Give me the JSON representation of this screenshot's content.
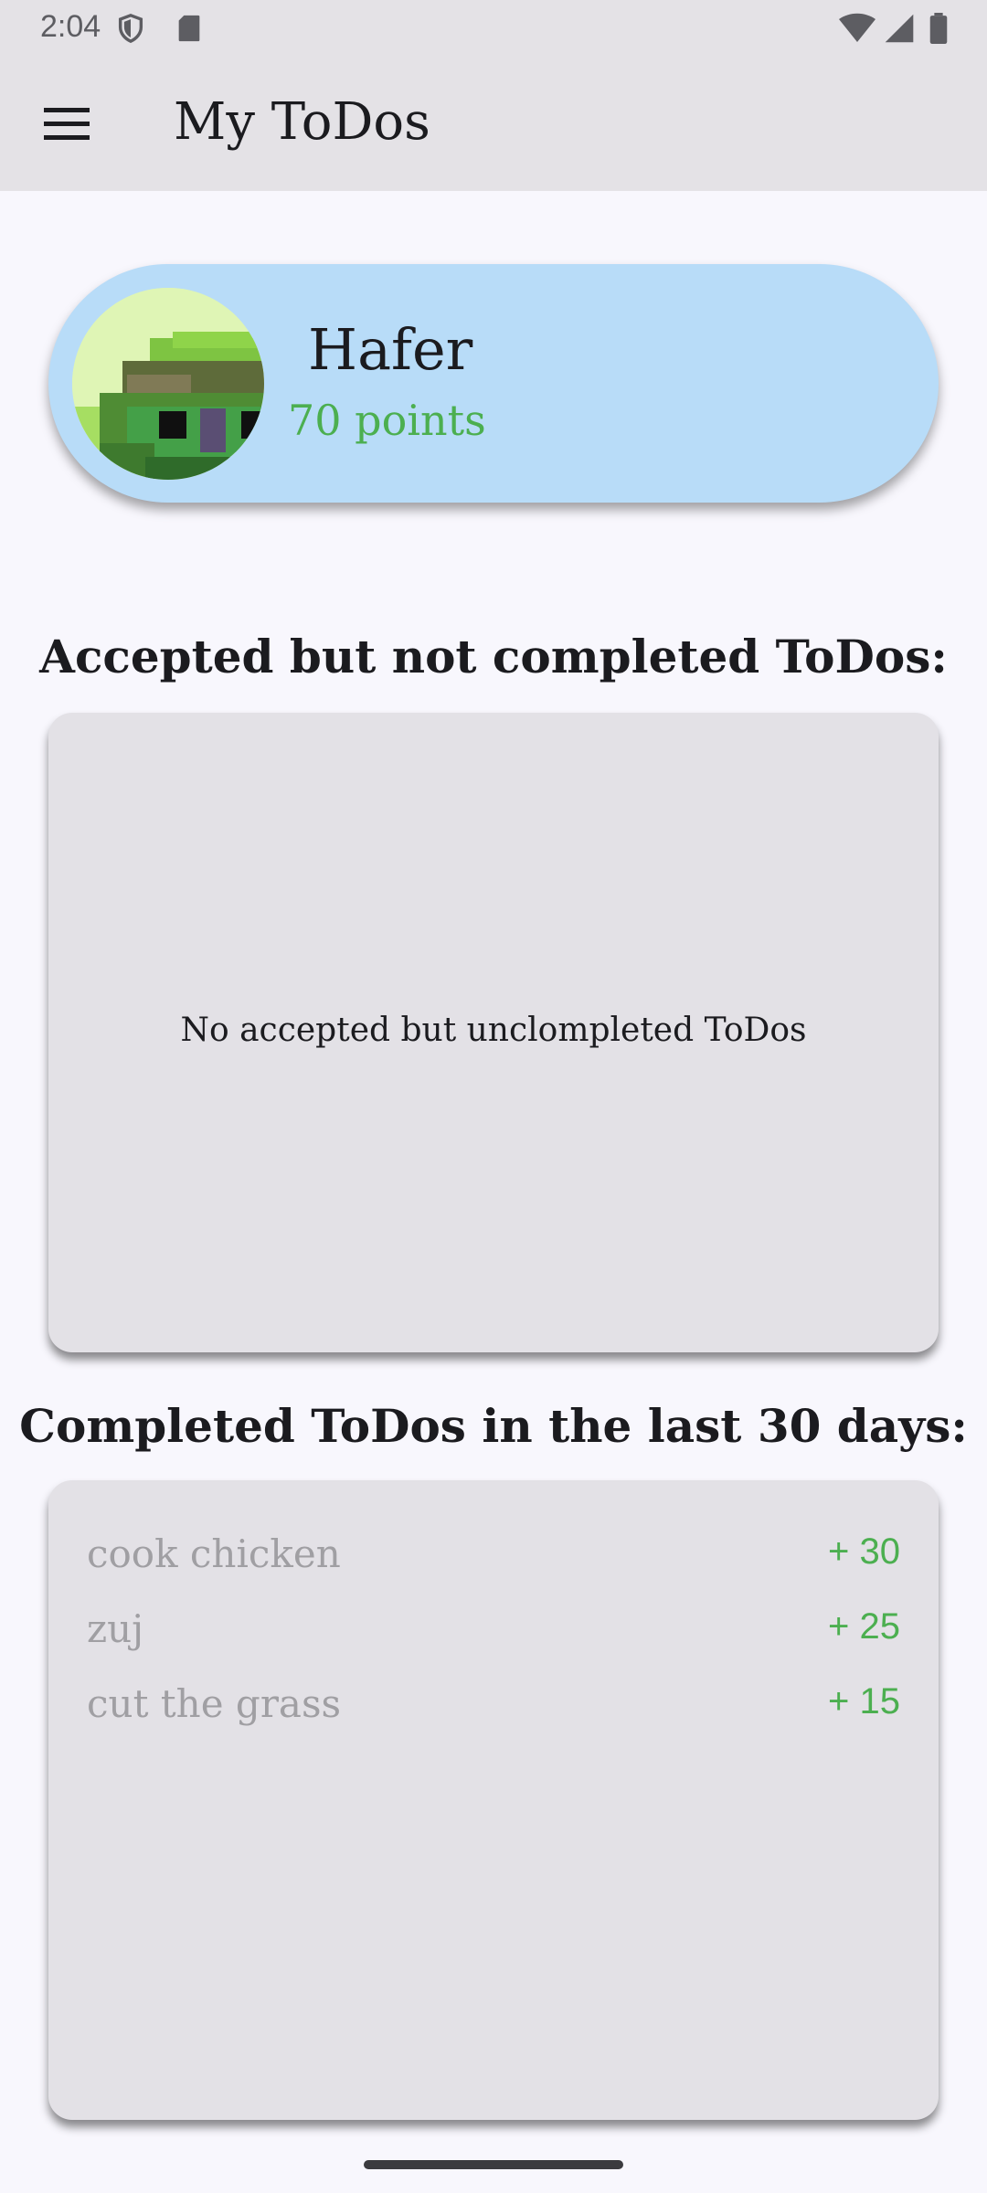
{
  "status_bar": {
    "time": "2:04",
    "icons_left": [
      "shield-icon",
      "sd-card-icon"
    ],
    "icons_right": [
      "wifi-icon",
      "signal-icon",
      "battery-icon"
    ]
  },
  "app_bar": {
    "title": "My ToDos",
    "menu_icon": "hamburger-menu-icon"
  },
  "profile": {
    "name": "Hafer",
    "points": "70 points",
    "card_color": "#b8dcf8",
    "points_color": "#4caf50"
  },
  "accepted_section": {
    "title": "Accepted but not completed ToDos:",
    "empty_message": "No accepted but unclompleted ToDos"
  },
  "completed_section": {
    "title": "Completed ToDos in the last 30 days:",
    "items": [
      {
        "name": "cook chicken",
        "points": "+ 30"
      },
      {
        "name": "zuj",
        "points": "+ 25"
      },
      {
        "name": "cut the grass",
        "points": "+ 15"
      }
    ]
  }
}
